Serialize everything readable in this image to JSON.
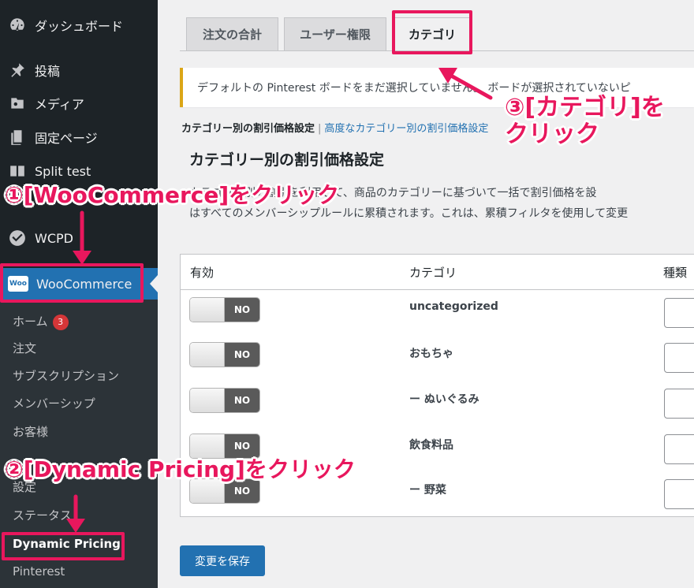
{
  "sidebar": {
    "items": [
      {
        "label": "ダッシュボード",
        "icon": "dashboard-icon"
      },
      {
        "label": "投稿",
        "icon": "pin-icon"
      },
      {
        "label": "メディア",
        "icon": "media-icon"
      },
      {
        "label": "固定ページ",
        "icon": "page-icon"
      },
      {
        "label": "Split test",
        "icon": "split-test-icon"
      },
      {
        "label": "WCPD",
        "icon": "check-badge-icon"
      }
    ],
    "woo": {
      "label": "WooCommerce",
      "icon": "woo-icon",
      "icon_text": "Woo"
    },
    "submenu": {
      "home": "ホーム",
      "home_badge": "3",
      "orders": "注文",
      "subscriptions": "サブスクリプション",
      "memberships": "メンバーシップ",
      "customers": "お客様",
      "settings": "設定",
      "status": "ステータス",
      "dynamic_pricing": "Dynamic Pricing",
      "pinterest": "Pinterest"
    }
  },
  "tabs": [
    "注文の合計",
    "ユーザー権限",
    "カテゴリ"
  ],
  "active_tab": "カテゴリ",
  "notice": "デフォルトの Pinterest ボードをまだ選択していません。 ボードが選択されていないピ",
  "subsubsub": {
    "current": "カテゴリー別の割引価格設定",
    "separator": "|",
    "link": "高度なカテゴリー別の割引価格設定"
  },
  "section_title": "カテゴリー別の割引価格設定",
  "description": {
    "line1": "カテゴリー別の割引を利用して、商品のカテゴリーに基づいて一括で割引価格を設",
    "line2": "はすべてのメンバーシップルールに累積されます。これは、累積フィルタを使用して変更"
  },
  "table": {
    "headers": {
      "enabled": "有効",
      "category": "カテゴリ",
      "type": "種類"
    },
    "rows": [
      {
        "toggle": "NO",
        "category": "uncategorized"
      },
      {
        "toggle": "NO",
        "category": "おもちゃ"
      },
      {
        "toggle": "NO",
        "category": "ー ぬいぐるみ"
      },
      {
        "toggle": "NO",
        "category": "飲食料品"
      },
      {
        "toggle": "NO",
        "category": "ー 野菜"
      }
    ]
  },
  "save_button": "変更を保存",
  "annotations": {
    "step1": "①[WooCommerce]をクリック",
    "step2": "②[Dynamic Pricing]をクリック",
    "step3_line1": "③[カテゴリ]を",
    "step3_line2": "クリック"
  },
  "colors": {
    "sidebar_bg": "#1d2327",
    "submenu_bg": "#2c3338",
    "accent": "#2271b1",
    "annotation": "#e8175d",
    "notice_border": "#dba617",
    "badge": "#d63638"
  }
}
